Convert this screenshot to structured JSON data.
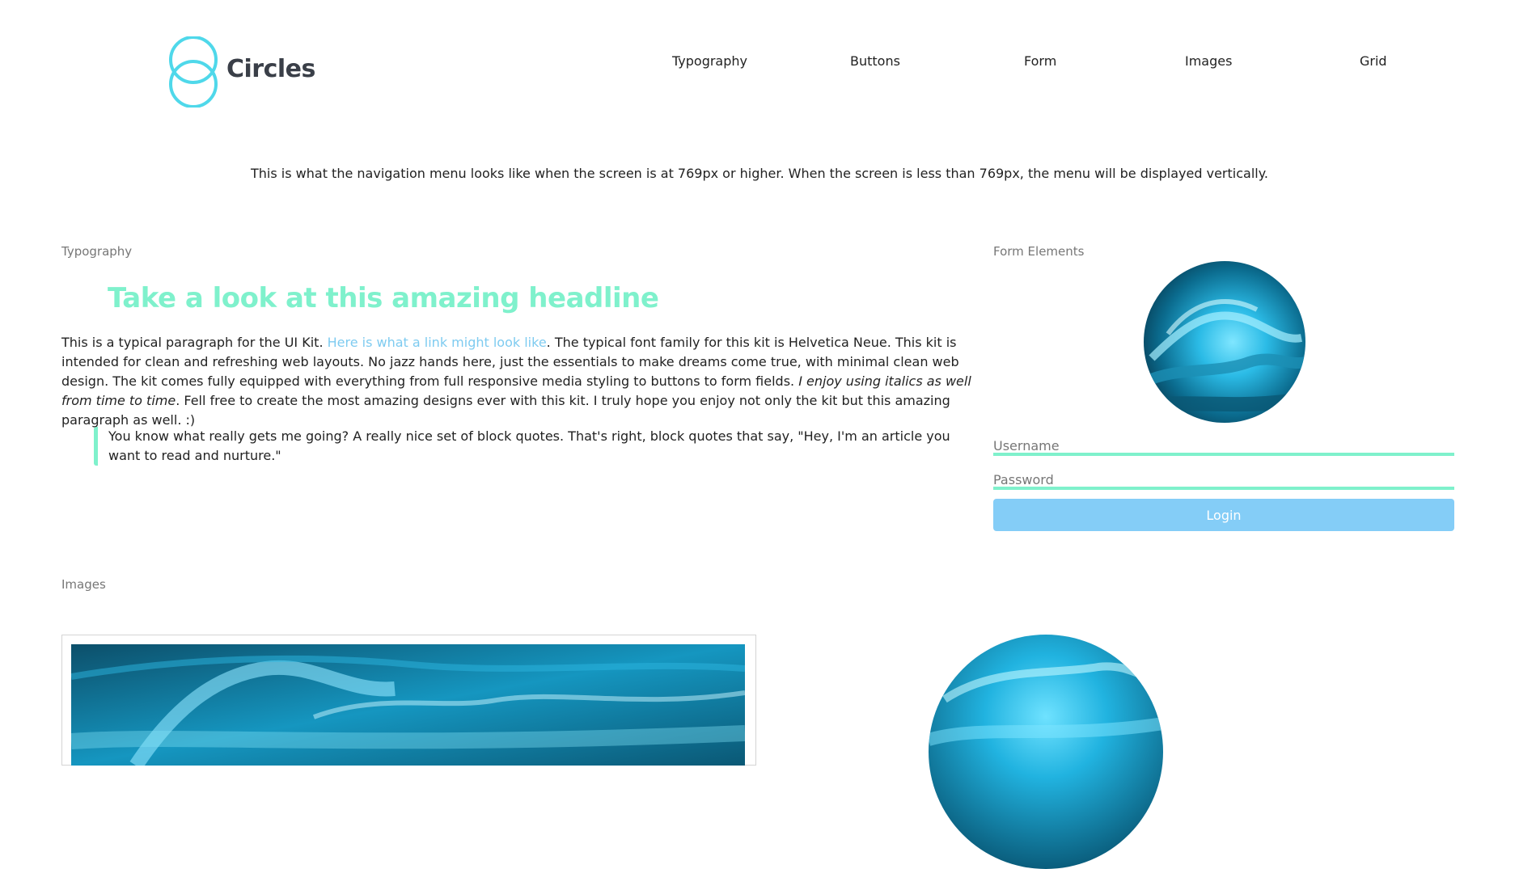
{
  "header": {
    "logo_text": "Circles",
    "nav": [
      "Typography",
      "Buttons",
      "Form",
      "Images",
      "Grid"
    ]
  },
  "note": "This is what the navigation menu looks like when the screen is at 769px or higher. When the screen is less than 769px, the menu will be displayed vertically.",
  "typography": {
    "section_label": "Typography",
    "headline": "Take a look at this amazing headline",
    "paragraph": {
      "intro": "This is a typical paragraph for the UI Kit. ",
      "link": "Here is what a link might look like",
      "middle": ". The typical font family for this kit is Helvetica Neue. This kit is intended for clean and refreshing web layouts. No jazz hands here, just the essentials to make dreams come true, with minimal clean web design. The kit comes fully equipped with everything from full responsive media styling to buttons to form fields. ",
      "italic": "I enjoy using italics as well from time to time",
      "outro": ". Fell free to create the most amazing designs ever with this kit. I truly hope you enjoy not only the kit but this amazing paragraph as well. :)"
    },
    "blockquote": "You know what really gets me going? A really nice set of block quotes. That's right, block quotes that say, \"Hey, I'm an article you want to read and nurture.\""
  },
  "form": {
    "section_label": "Form Elements",
    "username_label": "Username",
    "password_label": "Password",
    "login_label": "Login"
  },
  "images": {
    "section_label": "Images"
  },
  "colors": {
    "accent_green": "#7ff1cc",
    "accent_blue": "#84cdf7",
    "link_blue": "#7ecbf0",
    "logo_cyan": "#4fd8ea"
  }
}
